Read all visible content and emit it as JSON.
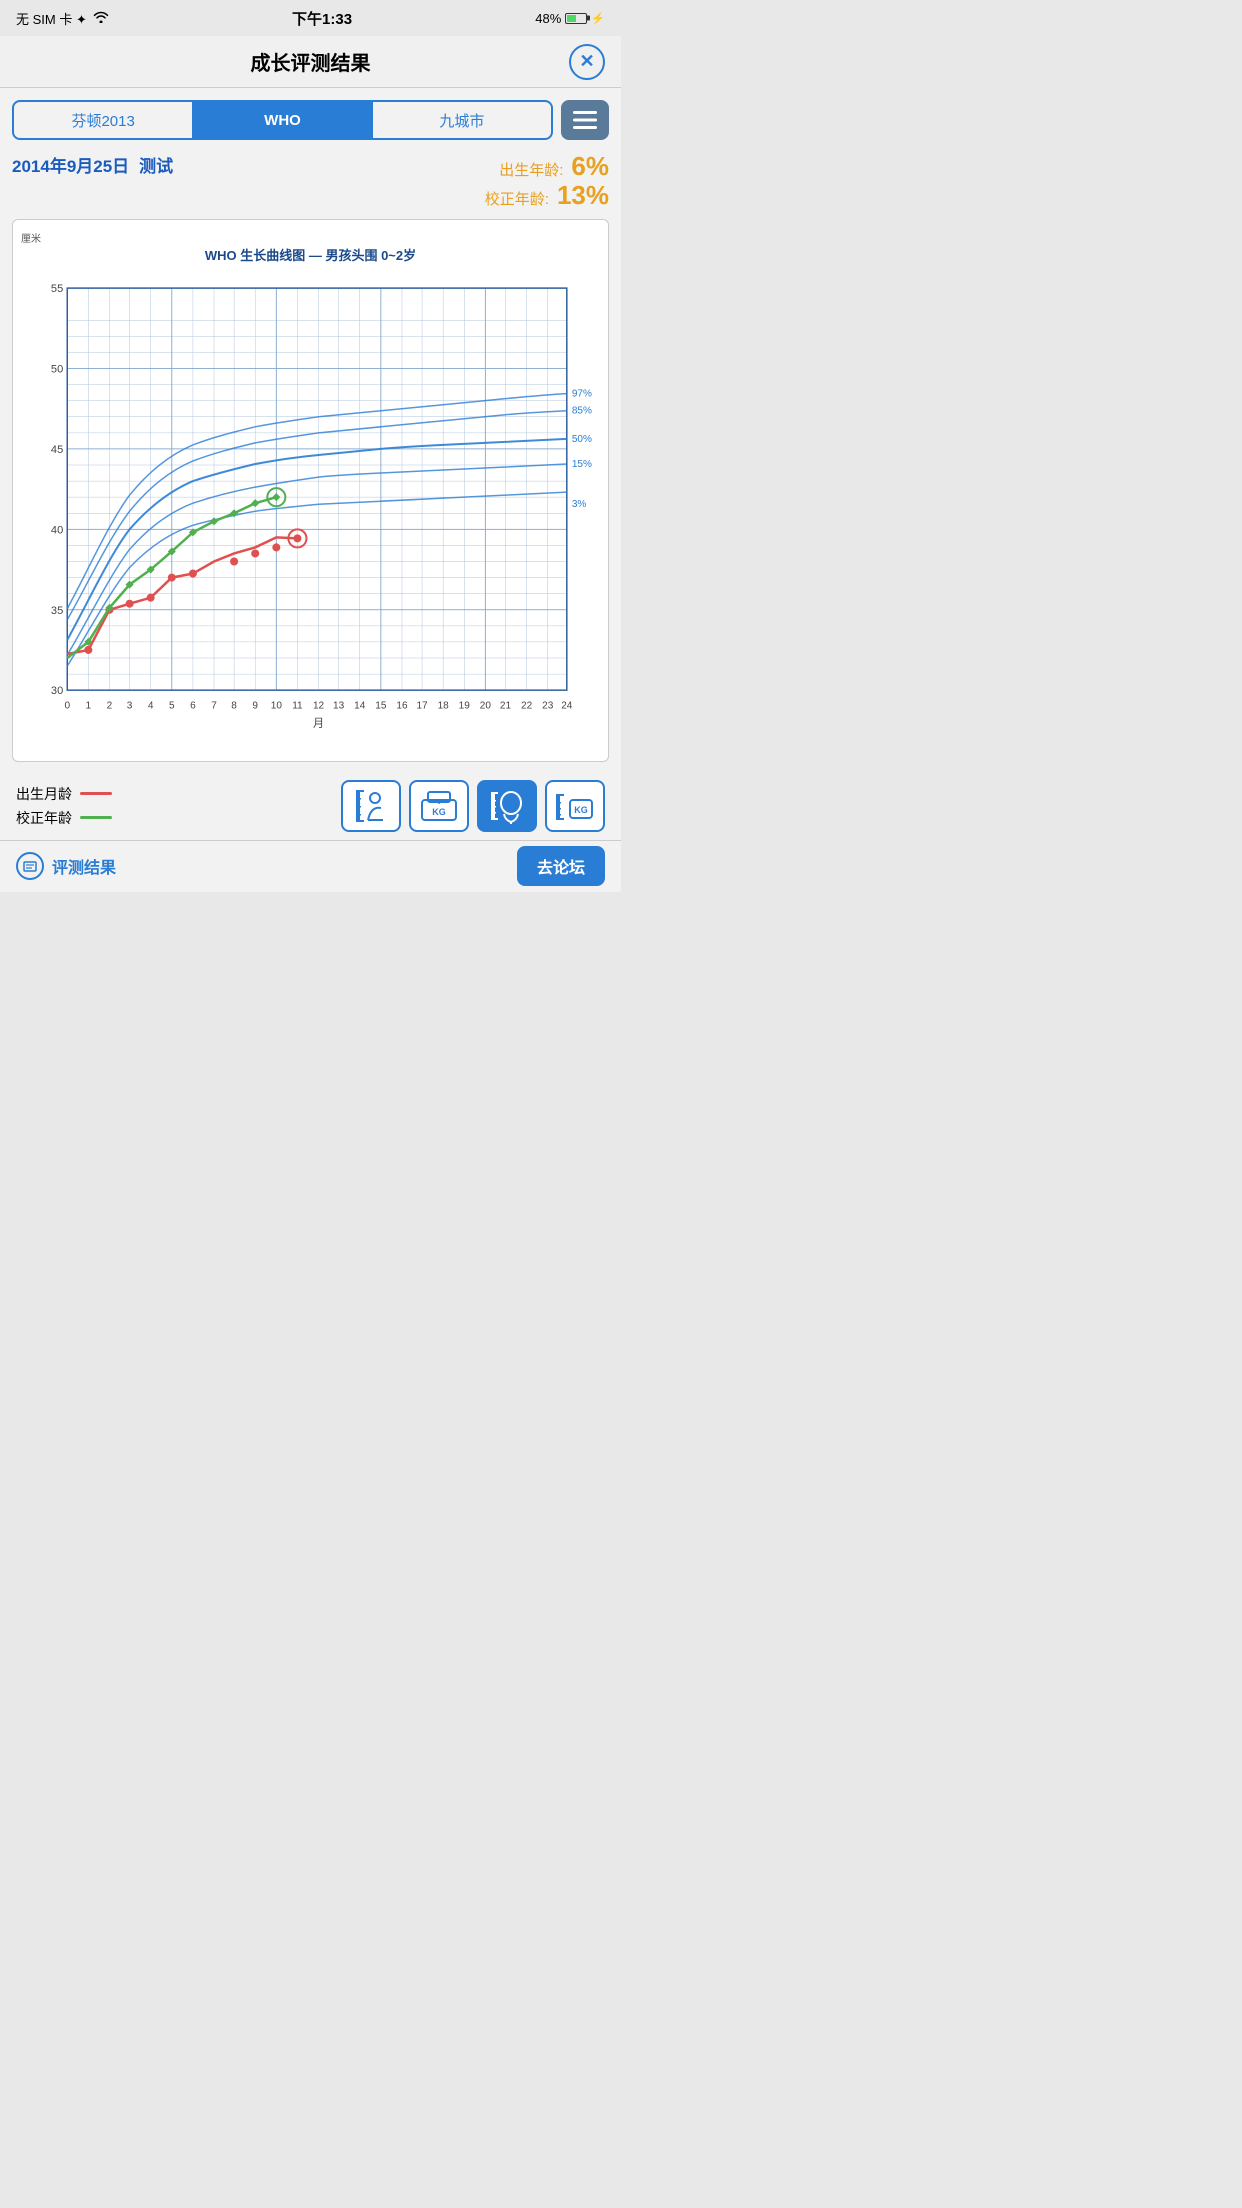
{
  "statusBar": {
    "left": "无 SIM 卡 ✦",
    "wifi": "WiFi",
    "time": "下午1:33",
    "battery": "48%"
  },
  "nav": {
    "title": "成长评测结果",
    "closeBtn": "✕"
  },
  "segmented": {
    "items": [
      "芬顿2013",
      "WHO",
      "九城市"
    ],
    "activeIndex": 1,
    "listBtnIcon": "≡"
  },
  "info": {
    "dateLabel": "2014年9月25日",
    "nameLabel": "测试",
    "birthAgeLabel": "出生年龄:",
    "birthAgeValue": "6%",
    "correctedAgeLabel": "校正年龄:",
    "correctedAgeValue": "13%"
  },
  "chart": {
    "title": "WHO 生长曲线图 — 男孩头围 0~2岁",
    "yLabel": "厘米",
    "yAxisLabels": [
      "55",
      "50",
      "45",
      "40",
      "35",
      "30"
    ],
    "xAxisLabels": [
      "0",
      "1",
      "2",
      "3",
      "4",
      "5",
      "6",
      "7",
      "8",
      "9",
      "10",
      "11",
      "12",
      "13",
      "14",
      "15",
      "16",
      "17",
      "18",
      "19",
      "20",
      "21",
      "22",
      "23",
      "24"
    ],
    "xAxisTitle": "月",
    "percentileLabels": [
      "97%",
      "85%",
      "50%",
      "15%",
      "3%"
    ]
  },
  "legend": {
    "items": [
      {
        "label": "出生月龄",
        "color": "#e05050"
      },
      {
        "label": "校正年龄",
        "color": "#50b050"
      }
    ]
  },
  "actions": [
    {
      "icon": "height-baby",
      "active": false
    },
    {
      "icon": "weight-kg",
      "active": false
    },
    {
      "icon": "head-silhouette",
      "active": true
    },
    {
      "icon": "length-kg",
      "active": false
    }
  ],
  "bottomBar": {
    "label": "评测结果",
    "forumBtn": "去论坛"
  }
}
